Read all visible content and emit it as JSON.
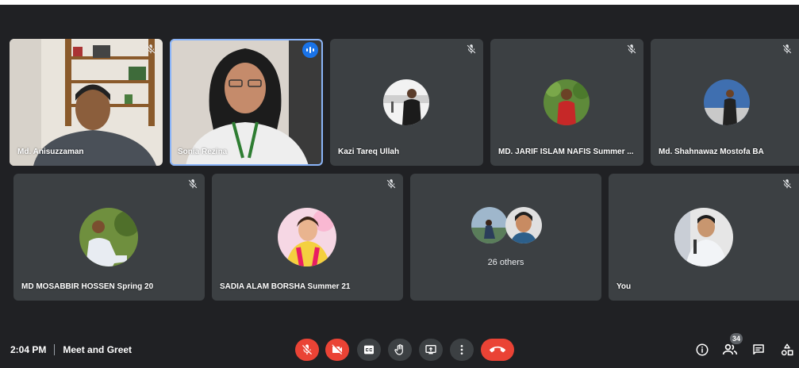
{
  "meeting": {
    "time": "2:04 PM",
    "title": "Meet and Greet",
    "participant_count": "34"
  },
  "tiles": [
    {
      "name": "Md. Anisuzzaman",
      "type": "video",
      "muted": true
    },
    {
      "name": "Sonia Rezina",
      "type": "video",
      "speaking": true
    },
    {
      "name": "Kazi Tareq Ullah",
      "type": "avatar",
      "muted": true
    },
    {
      "name": "MD. JARIF ISLAM NAFIS Summer ...",
      "type": "avatar",
      "muted": true
    },
    {
      "name": "Md. Shahnawaz Mostofa BA",
      "type": "avatar",
      "muted": true
    },
    {
      "name": "MD MOSABBIR HOSSEN Spring 20",
      "type": "avatar",
      "muted": true
    },
    {
      "name": "SADIA ALAM BORSHA Summer 21",
      "type": "avatar",
      "muted": true
    },
    {
      "name": "",
      "type": "others",
      "others_label": "26 others"
    },
    {
      "name": "You",
      "type": "avatar",
      "muted": true
    }
  ],
  "controls": {
    "mic": "mic-off-icon",
    "camera": "videocam-off-icon",
    "captions": "closed-captions-icon",
    "raise_hand": "hand-icon",
    "present": "present-screen-icon",
    "more": "more-vert-icon",
    "end_call": "call-end-icon"
  },
  "colors": {
    "background": "#202124",
    "tile": "#3c4043",
    "red": "#ea4335",
    "speaking": "#8ab4f8"
  }
}
